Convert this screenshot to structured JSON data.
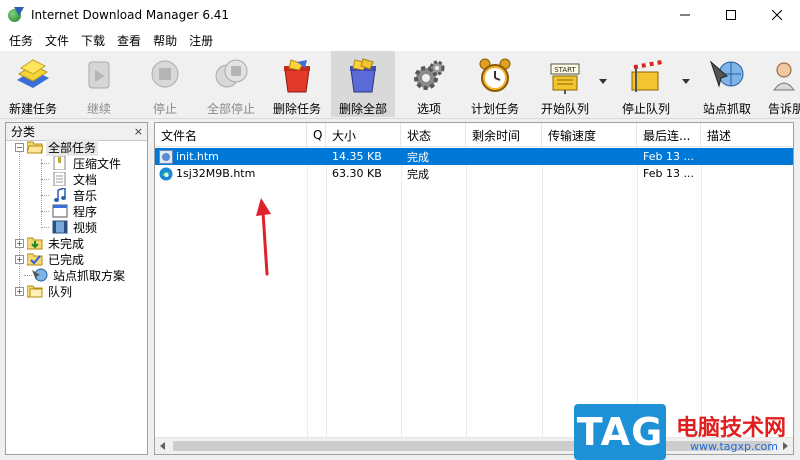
{
  "window": {
    "title": "Internet Download Manager 6.41",
    "controls": {
      "minimize": "—",
      "maximize": "☐",
      "close": "✕"
    }
  },
  "menu": [
    "任务",
    "文件",
    "下载",
    "查看",
    "帮助",
    "注册"
  ],
  "toolbar": {
    "buttons": [
      {
        "label": "新建任务",
        "icon": "new-task-icon",
        "enabled": true
      },
      {
        "label": "继续",
        "icon": "resume-icon",
        "enabled": false
      },
      {
        "label": "停止",
        "icon": "stop-icon",
        "enabled": false
      },
      {
        "label": "全部停止",
        "icon": "stop-all-icon",
        "enabled": false
      },
      {
        "label": "删除任务",
        "icon": "delete-task-icon",
        "enabled": true
      },
      {
        "label": "删除全部",
        "icon": "delete-all-icon",
        "enabled": true,
        "active": true
      },
      {
        "label": "选项",
        "icon": "options-gear-icon",
        "enabled": true
      },
      {
        "label": "计划任务",
        "icon": "scheduler-clock-icon",
        "enabled": true
      },
      {
        "label": "开始队列",
        "icon": "start-queue-icon",
        "enabled": true,
        "has_dropdown": true,
        "icon_text": "START"
      },
      {
        "label": "停止队列",
        "icon": "stop-queue-icon",
        "enabled": true,
        "has_dropdown": true
      },
      {
        "label": "站点抓取",
        "icon": "site-grabber-icon",
        "enabled": true
      },
      {
        "label": "告诉朋",
        "icon": "tell-friend-icon",
        "enabled": true
      }
    ]
  },
  "sidebar": {
    "header": "分类",
    "close_glyph": "×",
    "tree": [
      {
        "label": "全部任务",
        "icon": "folder-open-icon",
        "expander": "−",
        "level": 0,
        "selected": true
      },
      {
        "label": "压缩文件",
        "icon": "archive-icon",
        "level": 1
      },
      {
        "label": "文档",
        "icon": "document-icon",
        "level": 1
      },
      {
        "label": "音乐",
        "icon": "music-note-icon",
        "level": 1
      },
      {
        "label": "程序",
        "icon": "program-window-icon",
        "level": 1
      },
      {
        "label": "视频",
        "icon": "film-icon",
        "level": 1
      },
      {
        "label": "未完成",
        "icon": "unfinished-folder-icon",
        "expander": "+",
        "level": 0
      },
      {
        "label": "已完成",
        "icon": "finished-folder-icon",
        "expander": "+",
        "level": 0
      },
      {
        "label": "站点抓取方案",
        "icon": "grabber-project-icon",
        "level": 0
      },
      {
        "label": "队列",
        "icon": "queue-folder-icon",
        "expander": "+",
        "level": 0
      }
    ]
  },
  "list": {
    "columns": [
      "文件名",
      "Q",
      "大小",
      "状态",
      "剩余时间",
      "传输速度",
      "最后连...",
      "描述"
    ],
    "rows": [
      {
        "name": "init.htm",
        "q": "",
        "size": "14.35 KB",
        "status": "完成",
        "time_left": "",
        "speed": "",
        "last_try": "Feb 13 ...",
        "desc": "",
        "icon": "htm-file-icon",
        "selected": true
      },
      {
        "name": "1sj32M9B.htm",
        "q": "",
        "size": "63.30 KB",
        "status": "完成",
        "time_left": "",
        "speed": "",
        "last_try": "Feb 13 ...",
        "desc": "",
        "icon": "edge-browser-icon",
        "selected": false
      }
    ]
  },
  "watermark": {
    "tag": "TAG",
    "name": "电脑技术网",
    "url": "www.tagxp.com"
  },
  "colors": {
    "selection": "#0078d7",
    "annotation_arrow": "#e0202a",
    "watermark_blue": "#1e90d6",
    "watermark_red": "#e02020"
  }
}
